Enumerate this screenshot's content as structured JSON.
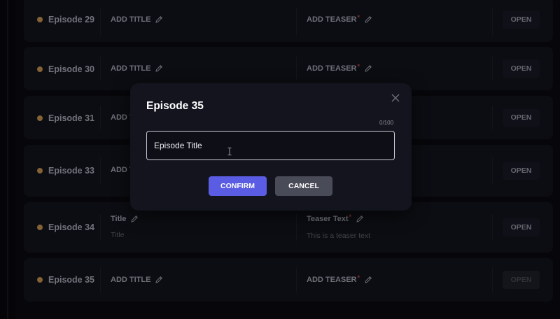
{
  "episodes": [
    {
      "name": "Episode 29",
      "title_label": "ADD TITLE",
      "teaser_label": "ADD TEASER",
      "action": "OPEN"
    },
    {
      "name": "Episode 30",
      "title_label": "ADD TITLE",
      "teaser_label": "ADD TEASER",
      "action": "OPEN"
    },
    {
      "name": "Episode 31",
      "title_label": "ADD T",
      "action": "OPEN"
    },
    {
      "name": "Episode 33",
      "title_label": "ADD T",
      "action": "OPEN"
    },
    {
      "name": "Episode 34",
      "title_label": "Title",
      "title_value": "Title",
      "teaser_label": "Teaser Text",
      "teaser_value": "This is a teaser text",
      "action": "OPEN"
    },
    {
      "name": "Episode 35",
      "title_label": "ADD TITLE",
      "teaser_label": "ADD TEASER",
      "action": "OPEN"
    }
  ],
  "required_marker": "*",
  "modal": {
    "title": "Episode 35",
    "counter": "0/100",
    "input_value": "Episode Title",
    "confirm_label": "CONFIRM",
    "cancel_label": "CANCEL"
  },
  "colors": {
    "accent": "#5a5ce3",
    "status_dot": "#b7884a",
    "required": "#b8463e"
  },
  "icons": {
    "edit": "pencil-icon",
    "close": "close-icon",
    "status": "status-dot-icon"
  }
}
